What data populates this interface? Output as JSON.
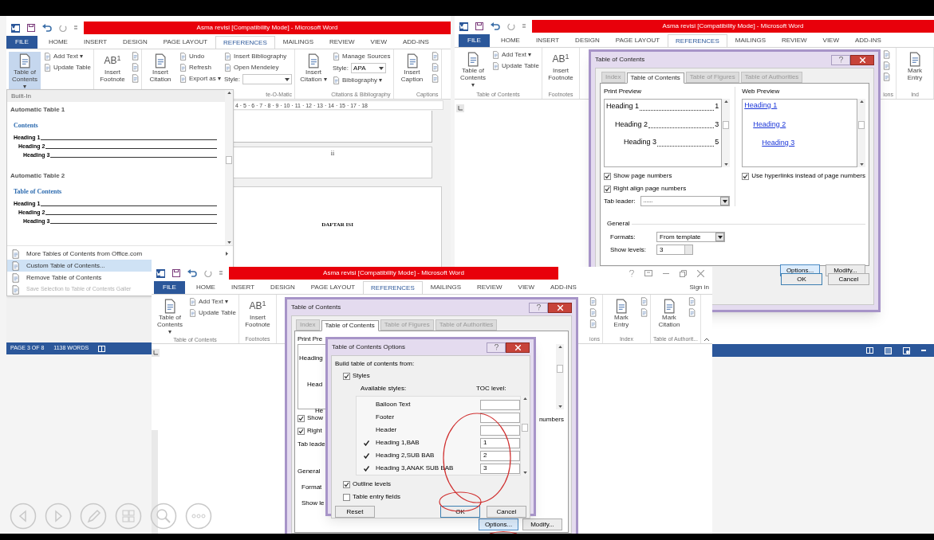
{
  "window_left": {
    "title": "Asma revisi [Compatibility Mode] -  Microsoft Word",
    "tabs": [
      {
        "label": "FILE",
        "kind": "file",
        "selected": false
      },
      {
        "label": "HOME",
        "kind": "tab",
        "selected": false
      },
      {
        "label": "INSERT",
        "kind": "tab",
        "selected": false
      },
      {
        "label": "DESIGN",
        "kind": "tab",
        "selected": false
      },
      {
        "label": "PAGE LAYOUT",
        "kind": "tab",
        "selected": false
      },
      {
        "label": "REFERENCES",
        "kind": "tab",
        "selected": true
      },
      {
        "label": "MAILINGS",
        "kind": "tab",
        "selected": false
      },
      {
        "label": "REVIEW",
        "kind": "tab",
        "selected": false
      },
      {
        "label": "VIEW",
        "kind": "tab",
        "selected": false
      },
      {
        "label": "ADD-INS",
        "kind": "tab",
        "selected": false
      }
    ],
    "ribbon": [
      {
        "columns": [
          [
            {
              "kind": "large",
              "label": "Table of Contents ▾",
              "pressed": true
            }
          ],
          [
            {
              "kind": "small",
              "label": "Add Text ▾"
            },
            {
              "kind": "small",
              "label": "Update Table"
            }
          ]
        ]
      },
      {
        "columns": [
          [
            {
              "kind": "large",
              "glyph": "AB$^{1}$",
              "label": "Insert Footnote",
              "pressed": false
            }
          ],
          [
            {
              "kind": "icon"
            },
            {
              "kind": "icon"
            },
            {
              "kind": "icon"
            }
          ]
        ]
      },
      {
        "label": "te-O-Matic",
        "columns": [
          [
            {
              "kind": "large",
              "label": "Insert Citation",
              "pressed": false
            }
          ],
          [
            {
              "kind": "small",
              "label": "Undo"
            },
            {
              "kind": "small",
              "label": "Refresh"
            },
            {
              "kind": "small",
              "label": "Export as ▾"
            }
          ],
          [
            {
              "kind": "small",
              "label": "Insert Bibliography"
            },
            {
              "kind": "small",
              "label": "Open Mendeley"
            },
            {
              "kind": "select",
              "label": "Style:"
            }
          ]
        ]
      },
      {
        "label": "Citations & Bibliography",
        "columns": [
          [
            {
              "kind": "large",
              "label": "Insert Citation ▾",
              "pressed": false
            }
          ],
          [
            {
              "kind": "small",
              "label": "Manage Sources"
            },
            {
              "kind": "select",
              "label": "Style:",
              "value": "APA"
            },
            {
              "kind": "small",
              "label": "Bibliography ▾"
            }
          ]
        ]
      },
      {
        "label": "Captions",
        "columns": [
          [
            {
              "kind": "large",
              "label": "Insert Caption",
              "pressed": false
            }
          ],
          [
            {
              "kind": "icon"
            },
            {
              "kind": "icon"
            },
            {
              "kind": "icon"
            }
          ]
        ]
      }
    ],
    "toc_menu": {
      "header": "Built-In",
      "gallery": [
        {
          "name": "Automatic Table 1",
          "heading": "Contents",
          "entries": [
            {
              "label": "Heading 1",
              "children": [
                {
                  "label": "Heading 2",
                  "children": [
                    {
                      "label": "Heading 3"
                    }
                  ]
                }
              ]
            }
          ]
        },
        {
          "name": "Automatic Table 2",
          "heading": "Table of Contents",
          "entries": [
            {
              "label": "Heading 1",
              "children": [
                {
                  "label": "Heading 2",
                  "children": [
                    {
                      "label": "Heading 3"
                    }
                  ]
                }
              ]
            }
          ]
        }
      ],
      "items": [
        {
          "label": "More Tables of Contents from Office.com",
          "submenu": true,
          "selected": false,
          "disabled": false
        },
        {
          "label": "Custom Table of Contents...",
          "submenu": false,
          "selected": true,
          "disabled": false
        },
        {
          "label": "Remove Table of Contents",
          "submenu": false,
          "selected": false,
          "disabled": false
        },
        {
          "label": "Save Selection to Table of Contents Galler",
          "submenu": false,
          "selected": false,
          "disabled": true
        }
      ]
    },
    "ruler": "4 · 5 · 6 · 7 · 8 · 9 · 10 · 11 · 12 · 13 · 14 · 15 · 17 · 18",
    "page_texts": [
      "ii",
      "DAFTAR ISI"
    ],
    "status_bar": [
      "PAGE 3 OF 8",
      "1138 WORDS"
    ]
  },
  "window_right": {
    "title": "Asma revisi [Compatibility Mode] -  Microsoft Word",
    "tabs": [
      {
        "label": "FILE",
        "kind": "file",
        "selected": false
      },
      {
        "label": "HOME",
        "kind": "tab",
        "selected": false
      },
      {
        "label": "INSERT",
        "kind": "tab",
        "selected": false
      },
      {
        "label": "DESIGN",
        "kind": "tab",
        "selected": false
      },
      {
        "label": "PAGE LAYOUT",
        "kind": "tab",
        "selected": false
      },
      {
        "label": "REFERENCES",
        "kind": "tab",
        "selected": true
      },
      {
        "label": "MAILINGS",
        "kind": "tab",
        "selected": false
      },
      {
        "label": "REVIEW",
        "kind": "tab",
        "selected": false
      },
      {
        "label": "VIEW",
        "kind": "tab",
        "selected": false
      },
      {
        "label": "ADD-INS",
        "kind": "tab",
        "selected": false
      }
    ],
    "ribbon_left": [
      {
        "label": "Table of Contents",
        "columns": [
          [
            {
              "kind": "large",
              "label": "Table of Contents ▾"
            }
          ],
          [
            {
              "kind": "small",
              "label": "Add Text ▾"
            },
            {
              "kind": "small",
              "label": "Update Table"
            }
          ]
        ]
      },
      {
        "label": "Footnotes",
        "columns": [
          [
            {
              "kind": "large",
              "glyph": "AB$^{1}$",
              "label": "Insert Footnote"
            }
          ]
        ]
      }
    ],
    "ribbon_right": [
      {
        "label": "ions",
        "columns": [
          [
            {
              "kind": "icon"
            },
            {
              "kind": "icon"
            },
            {
              "kind": "icon"
            }
          ]
        ]
      },
      {
        "label": "Ind",
        "columns": [
          [
            {
              "kind": "large",
              "label": "Mark Entry"
            }
          ]
        ]
      }
    ],
    "toc_dialog": {
      "title": "Table of Contents",
      "tabs": [
        {
          "label": "Index",
          "selected": false
        },
        {
          "label": "Table of Contents",
          "selected": true
        },
        {
          "label": "Table of Figures",
          "selected": false
        },
        {
          "label": "Table of Authorities",
          "selected": false
        }
      ],
      "print_preview": {
        "label": "Print Preview",
        "entries": [
          {
            "label": "Heading 1",
            "page": "1",
            "children": [
              {
                "label": "Heading 2",
                "page": "3",
                "children": [
                  {
                    "label": "Heading 3",
                    "page": "5"
                  }
                ]
              }
            ]
          }
        ]
      },
      "web_preview": {
        "label": "Web Preview",
        "entries": [
          {
            "label": "Heading 1",
            "children": [
              {
                "label": "Heading 2",
                "children": [
                  {
                    "label": "Heading 3"
                  }
                ]
              }
            ]
          }
        ]
      },
      "options": [
        {
          "label": "Show page numbers",
          "checked": true
        },
        {
          "label": "Right align page numbers",
          "checked": true
        }
      ],
      "tab_leader": {
        "label": "Tab leader:",
        "value": "......"
      },
      "hyperlinks": {
        "label": "Use hyperlinks instead of page numbers",
        "checked": true
      },
      "general": {
        "label": "General",
        "formats": {
          "label": "Formats:",
          "value": "From template"
        },
        "show_levels": {
          "label": "Show levels:",
          "value": "3"
        }
      },
      "content_buttons": [
        {
          "label": "Options...",
          "kind": "focused"
        },
        {
          "label": "Modify...",
          "kind": "normal"
        }
      ],
      "buttons": [
        {
          "label": "OK",
          "kind": "default"
        },
        {
          "label": "Cancel",
          "kind": "normal"
        }
      ]
    }
  },
  "window_front": {
    "title": "Asma revisi [Compatibility Mode] -  Microsoft Word",
    "tabs": [
      {
        "label": "FILE",
        "kind": "file",
        "selected": false
      },
      {
        "label": "HOME",
        "kind": "tab",
        "selected": false
      },
      {
        "label": "INSERT",
        "kind": "tab",
        "selected": false
      },
      {
        "label": "DESIGN",
        "kind": "tab",
        "selected": false
      },
      {
        "label": "PAGE LAYOUT",
        "kind": "tab",
        "selected": false
      },
      {
        "label": "REFERENCES",
        "kind": "tab",
        "selected": true
      },
      {
        "label": "MAILINGS",
        "kind": "tab",
        "selected": false
      },
      {
        "label": "REVIEW",
        "kind": "tab",
        "selected": false
      },
      {
        "label": "VIEW",
        "kind": "tab",
        "selected": false
      },
      {
        "label": "ADD-INS",
        "kind": "tab",
        "selected": false
      }
    ],
    "sign_in": "Sign in",
    "ribbon_left": [
      {
        "label": "Table of Contents",
        "columns": [
          [
            {
              "kind": "large",
              "label": "Table of Contents ▾"
            }
          ],
          [
            {
              "kind": "small",
              "label": "Add Text ▾"
            },
            {
              "kind": "small",
              "label": "Update Table"
            }
          ]
        ]
      },
      {
        "label": "Footnotes",
        "columns": [
          [
            {
              "kind": "large",
              "glyph": "AB$^{1}$",
              "label": "Insert Footnote"
            }
          ]
        ]
      }
    ],
    "ribbon_right": [
      {
        "label": "ions",
        "columns": [
          [
            {
              "kind": "icon"
            },
            {
              "kind": "icon"
            },
            {
              "kind": "icon"
            }
          ]
        ]
      },
      {
        "label": "Index",
        "columns": [
          [
            {
              "kind": "large",
              "label": "Mark Entry"
            }
          ],
          [
            {
              "kind": "icon"
            },
            {
              "kind": "icon"
            }
          ]
        ]
      },
      {
        "label": "Table of Authorit...",
        "columns": [
          [
            {
              "kind": "large",
              "label": "Mark Citation"
            }
          ],
          [
            {
              "kind": "icon"
            },
            {
              "kind": "icon"
            }
          ]
        ]
      }
    ],
    "toc_dialog": {
      "title": "Table of Contents",
      "tabs": [
        {
          "label": "Index",
          "selected": false
        },
        {
          "label": "Table of Contents",
          "selected": true
        },
        {
          "label": "Table of Figures",
          "selected": false
        },
        {
          "label": "Table of Authorities",
          "selected": false
        }
      ],
      "print_preview": {
        "label": "Print Pre",
        "entries": [
          {
            "label": "Heading",
            "children": [
              {
                "label": "Head",
                "children": [
                  {
                    "label": "He"
                  }
                ]
              }
            ]
          }
        ]
      },
      "options": [
        {
          "label": "Show",
          "checked": true
        },
        {
          "label": "Right",
          "checked": true
        }
      ],
      "tab_leader": {
        "label": "Tab leade"
      },
      "hyperlinks_tail": "numbers",
      "general": {
        "label": "General",
        "formats": {
          "label": "Format"
        },
        "show_levels": {
          "label": "Show le"
        }
      },
      "content_buttons": [
        {
          "label": "Options...",
          "kind": "focused"
        },
        {
          "label": "Modify...",
          "kind": "normal"
        }
      ]
    },
    "options_dialog": {
      "title": "Table of Contents Options",
      "build_label": "Build table of contents from:",
      "styles": {
        "label": "Styles",
        "checked": true
      },
      "columns": [
        "Available styles:",
        "TOC level:"
      ],
      "style_rows": [
        {
          "name": "Balloon Text",
          "used": false
        },
        {
          "name": "Footer",
          "used": false
        },
        {
          "name": "Header",
          "used": false
        },
        {
          "name": "Heading 1,BAB",
          "used": true,
          "level": "1"
        },
        {
          "name": "Heading 2,SUB BAB",
          "used": true,
          "level": "2"
        },
        {
          "name": "Heading 3,ANAK SUB BAB",
          "used": true,
          "level": "3"
        }
      ],
      "outline_levels": {
        "label": "Outline levels",
        "checked": true
      },
      "table_entry_fields": {
        "label": "Table entry fields",
        "checked": false
      },
      "buttons": [
        {
          "label": "Reset",
          "kind": "normal"
        },
        {
          "label": "OK",
          "kind": "default"
        },
        {
          "label": "Cancel",
          "kind": "normal"
        }
      ]
    }
  }
}
